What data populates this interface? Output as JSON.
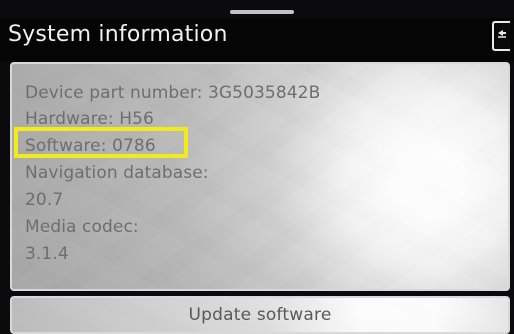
{
  "header": {
    "title": "System information"
  },
  "system_info": {
    "device_part_number": "Device part number: 3G5035842B",
    "hardware": "Hardware: H56",
    "software": "Software: 0786",
    "navigation_database_label": "Navigation database:",
    "navigation_database_value": "20.7",
    "media_codec_label": "Media codec:",
    "media_codec_value": "3.1.4"
  },
  "actions": {
    "update_software": "Update software"
  },
  "icons": {
    "back": "back-icon"
  },
  "colors": {
    "highlight": "#f1eb1a"
  }
}
